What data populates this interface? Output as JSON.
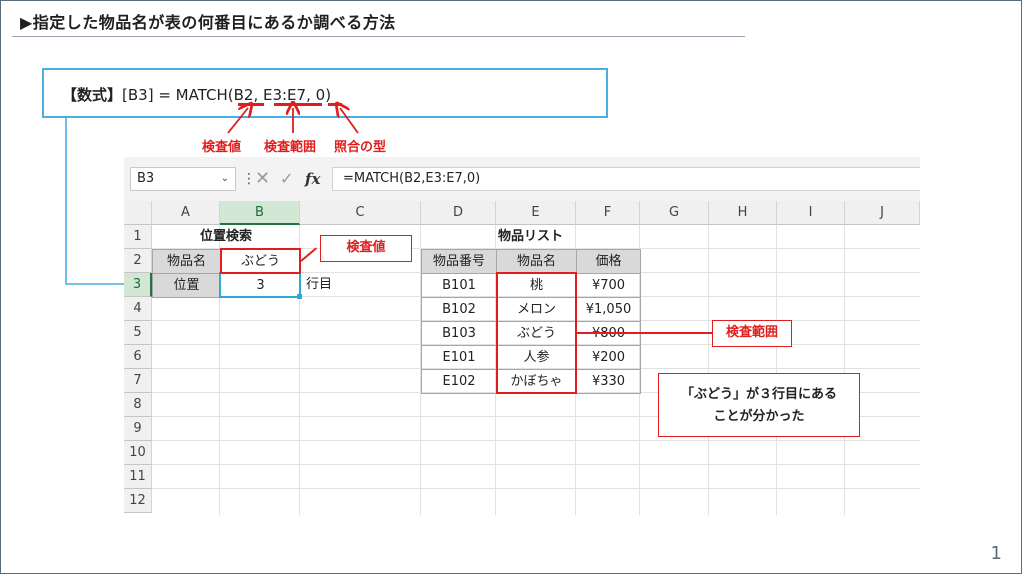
{
  "slide": {
    "title": "▶指定した物品名が表の何番目にあるか調べる方法",
    "page_number": "1"
  },
  "formula_box": {
    "label": "【数式】",
    "target": "[B3] = MATCH(",
    "arg1": "B2",
    "sep1": ", ",
    "arg2": "E3:E7",
    "sep2": ", ",
    "arg3": "0",
    "close": ")",
    "arg_labels": [
      "検査値",
      "検査範囲",
      "照合の型"
    ]
  },
  "excel": {
    "name_box": "B3",
    "formula": "=MATCH(B2,E3:E7,0)",
    "columns": [
      "A",
      "B",
      "C",
      "D",
      "E",
      "F",
      "G",
      "H",
      "I",
      "J"
    ],
    "rows": [
      "1",
      "2",
      "3",
      "4",
      "5",
      "6",
      "7",
      "8",
      "9",
      "10",
      "11",
      "12"
    ],
    "left_table": {
      "title": "位置検索",
      "label_item": "物品名",
      "value_item": "ぶどう",
      "label_position": "位置",
      "value_position": "3",
      "unit": "行目"
    },
    "right_table": {
      "title": "物品リスト",
      "headers": [
        "物品番号",
        "物品名",
        "価格"
      ],
      "rows": [
        [
          "B101",
          "桃",
          "¥700"
        ],
        [
          "B102",
          "メロン",
          "¥1,050"
        ],
        [
          "B103",
          "ぶどう",
          "¥800"
        ],
        [
          "E101",
          "人参",
          "¥200"
        ],
        [
          "E102",
          "かぼちゃ",
          "¥330"
        ]
      ]
    }
  },
  "callouts": {
    "lookup_value": "検査値",
    "lookup_range": "検査範囲",
    "result_note_line1": "「ぶどう」が３行目にある",
    "result_note_line2": "ことが分かった"
  },
  "colors": {
    "accent_red": "#e01e1e",
    "accent_blue": "#4aaee0",
    "excel_green": "#217346"
  }
}
